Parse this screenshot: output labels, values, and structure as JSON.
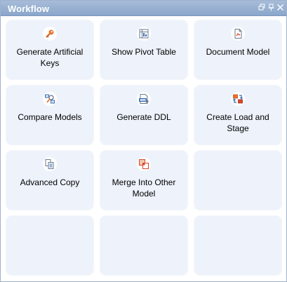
{
  "window": {
    "title": "Workflow",
    "buttons": [
      {
        "name": "restore",
        "icon": "restore-icon"
      },
      {
        "name": "pin",
        "icon": "pin-icon"
      },
      {
        "name": "close",
        "icon": "close-icon"
      }
    ]
  },
  "tiles": [
    {
      "label": "Generate Artificial Keys",
      "icon": "key-icon"
    },
    {
      "label": "Show Pivot Table",
      "icon": "pivot-table-icon"
    },
    {
      "label": "Document Model",
      "icon": "document-icon"
    },
    {
      "label": "Compare Models",
      "icon": "compare-models-icon"
    },
    {
      "label": "Generate DDL",
      "icon": "ddl-icon"
    },
    {
      "label": "Create Load and Stage",
      "icon": "load-stage-icon"
    },
    {
      "label": "Advanced Copy",
      "icon": "copy-icon"
    },
    {
      "label": "Merge Into Other Model",
      "icon": "merge-icon"
    },
    {
      "label": "",
      "icon": ""
    },
    {
      "label": "",
      "icon": ""
    },
    {
      "label": "",
      "icon": ""
    },
    {
      "label": "",
      "icon": ""
    }
  ],
  "colors": {
    "titlebar": "#8aa6cb",
    "tile_background": "#edf2fb",
    "accent_orange": "#e8732a",
    "accent_blue": "#3a6fb5"
  }
}
